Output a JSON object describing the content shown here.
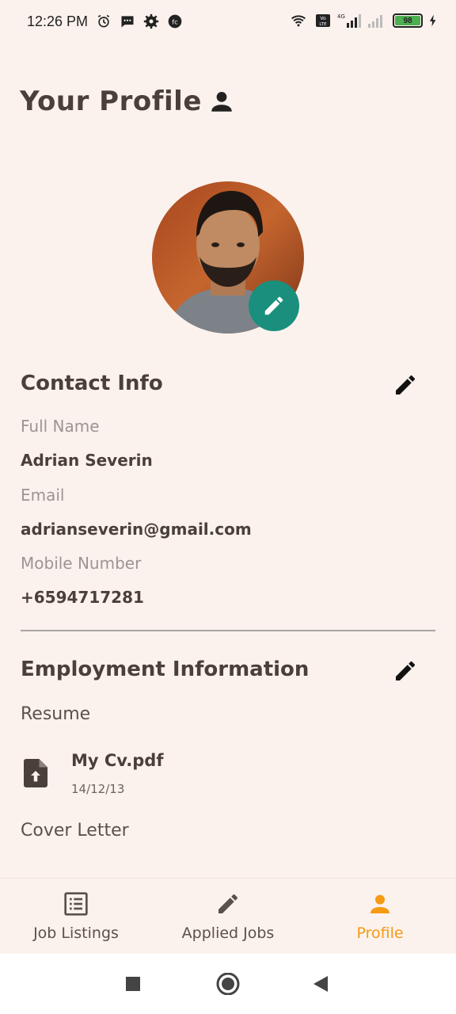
{
  "status_bar": {
    "time": "12:26 PM",
    "battery": "98",
    "network": "4G",
    "volte": "Vo LTE"
  },
  "header": {
    "title": "Your Profile"
  },
  "contact_info": {
    "title": "Contact Info",
    "full_name_label": "Full Name",
    "full_name": "Adrian Severin",
    "email_label": "Email",
    "email": "adrianseverin@gmail.com",
    "mobile_label": "Mobile Number",
    "mobile": "+6594717281"
  },
  "employment": {
    "title": "Employment Information",
    "resume_label": "Resume",
    "resume_file": "My Cv.pdf",
    "resume_date": "14/12/13",
    "cover_letter_label": "Cover Letter"
  },
  "bottom_nav": {
    "items": [
      {
        "label": "Job Listings",
        "icon": "list-icon"
      },
      {
        "label": "Applied Jobs",
        "icon": "pencil-icon"
      },
      {
        "label": "Profile",
        "icon": "person-icon"
      }
    ],
    "active_color": "#f49a14"
  },
  "colors": {
    "background": "#fcf2ed",
    "accent": "#1b8f7d",
    "text": "#4a3f39"
  }
}
